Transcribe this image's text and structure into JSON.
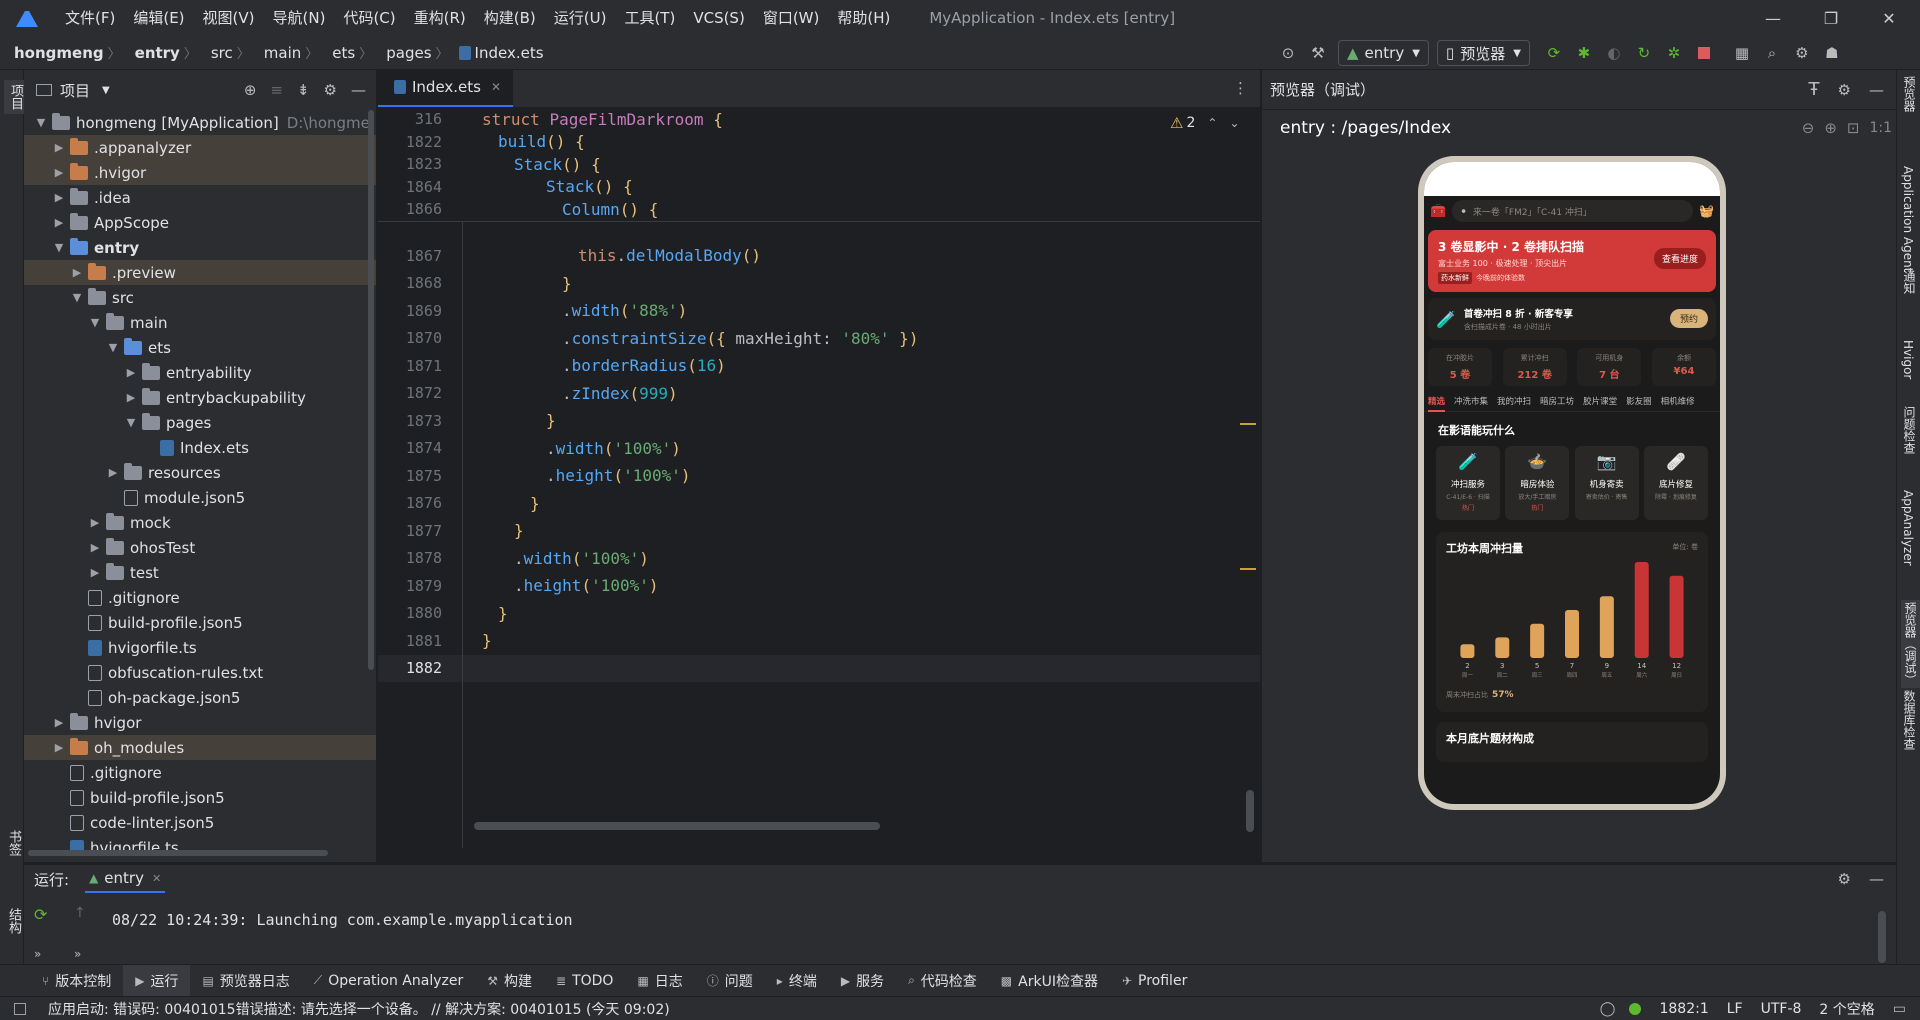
{
  "window": {
    "title": "MyApplication - Index.ets [entry]",
    "menus": [
      "文件(F)",
      "编辑(E)",
      "视图(V)",
      "导航(N)",
      "代码(C)",
      "重构(R)",
      "构建(B)",
      "运行(U)",
      "工具(T)",
      "VCS(S)",
      "窗口(W)",
      "帮助(H)"
    ],
    "controls": {
      "minimize": "—",
      "maximize": "❐",
      "close": "✕"
    }
  },
  "breadcrumb": [
    "hongmeng",
    "entry",
    "src",
    "main",
    "ets",
    "pages",
    "Index.ets"
  ],
  "toolbar": {
    "run_config": "entry",
    "device": "预览器"
  },
  "left_stripe": {
    "project": "项目",
    "bookmarks": "书签",
    "structure": "结构"
  },
  "project_panel": {
    "title": "项目",
    "tree": [
      {
        "label": "hongmeng [MyApplication]",
        "suffix": "D:\\hongme",
        "indent": 0,
        "arrow": "▼",
        "icon": "folder-grey",
        "hl": false,
        "bold_part": "[MyApplication]"
      },
      {
        "label": ".appanalyzer",
        "indent": 1,
        "arrow": "▶",
        "icon": "folder-orange",
        "hl": true
      },
      {
        "label": ".hvigor",
        "indent": 1,
        "arrow": "▶",
        "icon": "folder-orange",
        "hl": true
      },
      {
        "label": ".idea",
        "indent": 1,
        "arrow": "▶",
        "icon": "folder-grey",
        "hl": false
      },
      {
        "label": "AppScope",
        "indent": 1,
        "arrow": "▶",
        "icon": "folder-grey",
        "hl": false
      },
      {
        "label": "entry",
        "indent": 1,
        "arrow": "▼",
        "icon": "folder-blue",
        "hl": false,
        "bold": true
      },
      {
        "label": ".preview",
        "indent": 2,
        "arrow": "▶",
        "icon": "folder-orange",
        "hl": true
      },
      {
        "label": "src",
        "indent": 2,
        "arrow": "▼",
        "icon": "folder-grey",
        "hl": false
      },
      {
        "label": "main",
        "indent": 3,
        "arrow": "▼",
        "icon": "folder-grey",
        "hl": false
      },
      {
        "label": "ets",
        "indent": 4,
        "arrow": "▼",
        "icon": "folder-blue",
        "hl": false
      },
      {
        "label": "entryability",
        "indent": 5,
        "arrow": "▶",
        "icon": "folder-grey",
        "hl": false
      },
      {
        "label": "entrybackupability",
        "indent": 5,
        "arrow": "▶",
        "icon": "folder-grey",
        "hl": false
      },
      {
        "label": "pages",
        "indent": 5,
        "arrow": "▼",
        "icon": "folder-grey",
        "hl": false
      },
      {
        "label": "Index.ets",
        "indent": 6,
        "arrow": "",
        "icon": "file-ts",
        "hl": false
      },
      {
        "label": "resources",
        "indent": 4,
        "arrow": "▶",
        "icon": "folder-grey",
        "hl": false
      },
      {
        "label": "module.json5",
        "indent": 4,
        "arrow": "",
        "icon": "file",
        "hl": false
      },
      {
        "label": "mock",
        "indent": 3,
        "arrow": "▶",
        "icon": "folder-grey",
        "hl": false
      },
      {
        "label": "ohosTest",
        "indent": 3,
        "arrow": "▶",
        "icon": "folder-grey",
        "hl": false
      },
      {
        "label": "test",
        "indent": 3,
        "arrow": "▶",
        "icon": "folder-grey",
        "hl": false
      },
      {
        "label": ".gitignore",
        "indent": 2,
        "arrow": "",
        "icon": "file",
        "hl": false
      },
      {
        "label": "build-profile.json5",
        "indent": 2,
        "arrow": "",
        "icon": "file",
        "hl": false
      },
      {
        "label": "hvigorfile.ts",
        "indent": 2,
        "arrow": "",
        "icon": "file-ts",
        "hl": false
      },
      {
        "label": "obfuscation-rules.txt",
        "indent": 2,
        "arrow": "",
        "icon": "file",
        "hl": false
      },
      {
        "label": "oh-package.json5",
        "indent": 2,
        "arrow": "",
        "icon": "file",
        "hl": false
      },
      {
        "label": "hvigor",
        "indent": 1,
        "arrow": "▶",
        "icon": "folder-grey",
        "hl": false
      },
      {
        "label": "oh_modules",
        "indent": 1,
        "arrow": "▶",
        "icon": "folder-orange",
        "hl": true
      },
      {
        "label": ".gitignore",
        "indent": 1,
        "arrow": "",
        "icon": "file",
        "hl": false
      },
      {
        "label": "build-profile.json5",
        "indent": 1,
        "arrow": "",
        "icon": "file",
        "hl": false
      },
      {
        "label": "code-linter.json5",
        "indent": 1,
        "arrow": "",
        "icon": "file",
        "hl": false
      },
      {
        "label": "hvigorfile.ts",
        "indent": 1,
        "arrow": "",
        "icon": "file-ts",
        "hl": false
      }
    ]
  },
  "editor": {
    "tab": "Index.ets",
    "warnings": "2",
    "sticky": [
      {
        "ln": "316",
        "code": [
          [
            "kw",
            "struct "
          ],
          [
            "ty",
            "PageFilmDarkroom "
          ],
          [
            "yl",
            "{"
          ]
        ],
        "indent": 0
      },
      {
        "ln": "1822",
        "code": [
          [
            "fn",
            "build"
          ],
          [
            "yl",
            "() {"
          ]
        ],
        "indent": 1
      },
      {
        "ln": "1823",
        "code": [
          [
            "fn",
            "Stack"
          ],
          [
            "yl",
            "() {"
          ]
        ],
        "indent": 2
      },
      {
        "ln": "1864",
        "code": [
          [
            "fn",
            "Stack"
          ],
          [
            "yl",
            "() {"
          ]
        ],
        "indent": 4
      },
      {
        "ln": "1866",
        "code": [
          [
            "fn",
            "Column"
          ],
          [
            "yl",
            "() {"
          ]
        ],
        "indent": 5
      }
    ],
    "lines": [
      {
        "ln": "1867",
        "code": [
          [
            "kw",
            "this"
          ],
          [
            "tx",
            "."
          ],
          [
            "fn",
            "delModalBody"
          ],
          [
            "yl",
            "()"
          ]
        ],
        "indent": 6
      },
      {
        "ln": "1868",
        "code": [
          [
            "yl",
            "}"
          ]
        ],
        "indent": 5
      },
      {
        "ln": "1869",
        "code": [
          [
            "tx",
            "."
          ],
          [
            "fn",
            "width"
          ],
          [
            "yl",
            "("
          ],
          [
            "st",
            "'88%'"
          ],
          [
            "yl",
            ")"
          ]
        ],
        "indent": 5
      },
      {
        "ln": "1870",
        "code": [
          [
            "tx",
            "."
          ],
          [
            "fn",
            "constraintSize"
          ],
          [
            "yl",
            "({ "
          ],
          [
            "tx",
            "maxHeight: "
          ],
          [
            "st",
            "'80%'"
          ],
          [
            "yl",
            " })"
          ]
        ],
        "indent": 5
      },
      {
        "ln": "1871",
        "code": [
          [
            "tx",
            "."
          ],
          [
            "fn",
            "borderRadius"
          ],
          [
            "yl",
            "("
          ],
          [
            "nm",
            "16"
          ],
          [
            "yl",
            ")"
          ]
        ],
        "indent": 5
      },
      {
        "ln": "1872",
        "code": [
          [
            "tx",
            "."
          ],
          [
            "fn",
            "zIndex"
          ],
          [
            "yl",
            "("
          ],
          [
            "nm",
            "999"
          ],
          [
            "yl",
            ")"
          ]
        ],
        "indent": 5
      },
      {
        "ln": "1873",
        "code": [
          [
            "yl",
            "}"
          ]
        ],
        "indent": 4
      },
      {
        "ln": "1874",
        "code": [
          [
            "tx",
            "."
          ],
          [
            "fn",
            "width"
          ],
          [
            "yl",
            "("
          ],
          [
            "st",
            "'100%'"
          ],
          [
            "yl",
            ")"
          ]
        ],
        "indent": 4
      },
      {
        "ln": "1875",
        "code": [
          [
            "tx",
            "."
          ],
          [
            "fn",
            "height"
          ],
          [
            "yl",
            "("
          ],
          [
            "st",
            "'100%'"
          ],
          [
            "yl",
            ")"
          ]
        ],
        "indent": 4
      },
      {
        "ln": "1876",
        "code": [
          [
            "yl",
            "}"
          ]
        ],
        "indent": 3
      },
      {
        "ln": "1877",
        "code": [
          [
            "yl",
            "}"
          ]
        ],
        "indent": 2
      },
      {
        "ln": "1878",
        "code": [
          [
            "tx",
            "."
          ],
          [
            "fn",
            "width"
          ],
          [
            "yl",
            "("
          ],
          [
            "st",
            "'100%'"
          ],
          [
            "yl",
            ")"
          ]
        ],
        "indent": 2
      },
      {
        "ln": "1879",
        "code": [
          [
            "tx",
            "."
          ],
          [
            "fn",
            "height"
          ],
          [
            "yl",
            "("
          ],
          [
            "st",
            "'100%'"
          ],
          [
            "yl",
            ")"
          ]
        ],
        "indent": 2
      },
      {
        "ln": "1880",
        "code": [
          [
            "yl",
            "}"
          ]
        ],
        "indent": 1
      },
      {
        "ln": "1881",
        "code": [
          [
            "yl",
            "}"
          ]
        ],
        "indent": 0
      },
      {
        "ln": "1882",
        "code": [],
        "indent": 0,
        "current": true
      }
    ]
  },
  "preview": {
    "title": "预览器（调试）",
    "route": "entry : /pages/Index",
    "zoom_label": "1:1",
    "phone": {
      "search_placeholder": "来一卷「FM2」「C-41 冲扫」",
      "banner_title": "3 卷显影中 · 2 卷排队扫描",
      "banner_sub": "富士业务 100 · 极速处理 · 顶尖出片",
      "banner_tag": "药水新鲜",
      "banner_tag2": "今晚前的体验数",
      "banner_btn": "查看进度",
      "promo_title": "首卷冲扫 8 折 · 新客专享",
      "promo_sub": "含扫描成片卷 · 48 小时出片",
      "promo_btn": "预约",
      "stats": [
        {
          "label": "在冲胶片",
          "value": "5 卷"
        },
        {
          "label": "累计冲扫",
          "value": "212 卷"
        },
        {
          "label": "可用机身",
          "value": "7 台"
        },
        {
          "label": "余额",
          "value": "¥64"
        }
      ],
      "tabs": [
        "精选",
        "冲洗市集",
        "我的冲扫",
        "暗房工坊",
        "胶片课堂",
        "影友圈",
        "相机维修"
      ],
      "section_title": "在影语能玩什么",
      "services": [
        {
          "icon": "🧪",
          "title": "冲扫服务",
          "sub": "C-41/E-6 · 扫描",
          "tag": "热门"
        },
        {
          "icon": "🍲",
          "title": "暗房体验",
          "sub": "放大/手工暗房",
          "tag": "热门"
        },
        {
          "icon": "📷",
          "title": "机身寄卖",
          "sub": "寄卖估价 · 寄售",
          "tag": ""
        },
        {
          "icon": "🩹",
          "title": "底片修复",
          "sub": "除霉 · 划痕修复",
          "tag": ""
        }
      ],
      "chart_title": "工坊本周冲扫量",
      "chart_unit": "单位: 卷",
      "chart_footer": "周末冲扫占比",
      "chart_footer_value": "57%",
      "bottom_title": "本月底片题材构成"
    }
  },
  "chart_data": {
    "type": "bar",
    "categories": [
      "周一",
      "周二",
      "周三",
      "周四",
      "周五",
      "周六",
      "周日"
    ],
    "values": [
      2,
      3,
      5,
      7,
      9,
      14,
      12
    ],
    "title": "工坊本周冲扫量",
    "ylim": [
      0,
      14
    ]
  },
  "run_panel": {
    "label": "运行:",
    "tab": "entry",
    "log": "08/22 10:24:39: Launching com.example.myapplication"
  },
  "tool_windows": [
    "版本控制",
    "运行",
    "预览器日志",
    "Operation Analyzer",
    "构建",
    "TODO",
    "日志",
    "问题",
    "终端",
    "服务",
    "代码检查",
    "ArkUI检查器",
    "Profiler"
  ],
  "right_stripe": [
    "预览器",
    "Application Agent",
    "通知",
    "Hvigor",
    "问题检查",
    "AppAnalyzer",
    "预览器（调试）",
    "数据库检查"
  ],
  "status": {
    "message": "应用启动: 错误码: 00401015错误描述: 请先选择一个设备。 // 解决方案: 00401015 (今天 09:02)",
    "position": "1882:1",
    "line_sep": "LF",
    "encoding": "UTF-8",
    "indent": "2 个空格"
  },
  "colors": {
    "accent": "#3574f0",
    "banner_red": "#d23a3a",
    "bar_orange": "#e0a35a",
    "bar_red": "#c93535",
    "gold": "#d8b37a"
  }
}
